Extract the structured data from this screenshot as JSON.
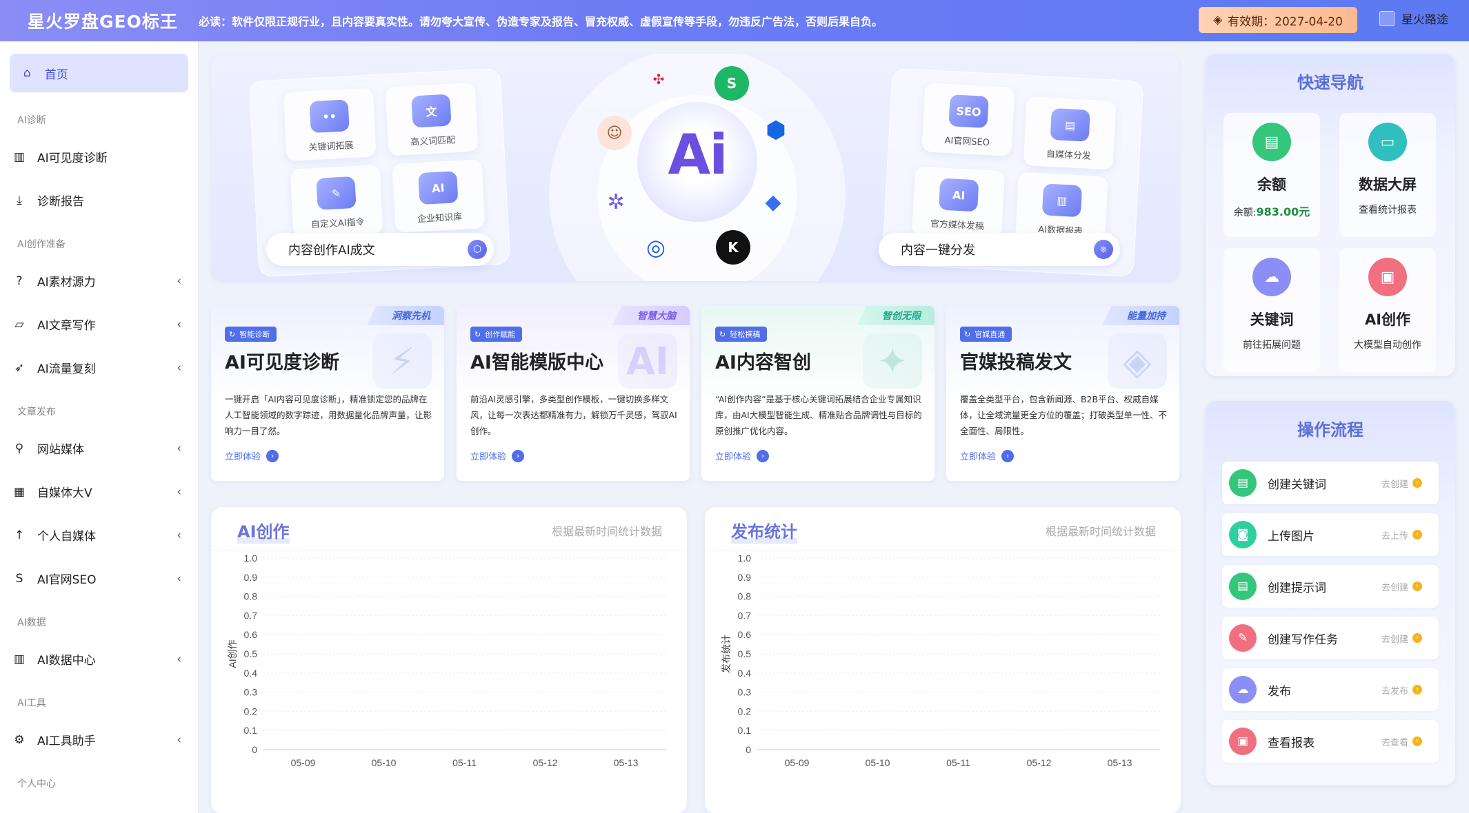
{
  "header": {
    "brand": "星火罗盘GEO标王",
    "notice": "必读：软件仅限正规行业，且内容要真实性。请勿夸大宣传、伪造专家及报告、冒充权威、虚假宣传等手段，勿违反广告法，否则后果自负。",
    "validity": "有效期：2027-04-20",
    "username": "星火路途"
  },
  "sidebar": {
    "home": "首页",
    "sections": [
      {
        "title": "AI诊断",
        "items": [
          {
            "label": "AI可见度诊断",
            "icon": "bar-chart-icon",
            "chevron": false
          },
          {
            "label": "诊断报告",
            "icon": "download-icon",
            "chevron": false
          }
        ]
      },
      {
        "title": "AI创作准备",
        "items": [
          {
            "label": "AI素材源力",
            "icon": "question-icon",
            "chevron": true
          },
          {
            "label": "AI文章写作",
            "icon": "folder-icon",
            "chevron": true
          },
          {
            "label": "AI流量复刻",
            "icon": "rocket-icon",
            "chevron": true
          }
        ]
      },
      {
        "title": "文章发布",
        "items": [
          {
            "label": "网站媒体",
            "icon": "search-icon",
            "chevron": true
          },
          {
            "label": "自媒体大V",
            "icon": "grid-icon",
            "chevron": true
          },
          {
            "label": "个人自媒体",
            "icon": "arrow-up-icon",
            "chevron": true
          },
          {
            "label": "AI官网SEO",
            "icon": "s-icon",
            "chevron": true
          }
        ]
      },
      {
        "title": "AI数据",
        "items": [
          {
            "label": "AI数据中心",
            "icon": "bar-chart-icon",
            "chevron": true
          }
        ]
      },
      {
        "title": "AI工具",
        "items": [
          {
            "label": "AI工具助手",
            "icon": "gear-icon",
            "chevron": true
          }
        ]
      },
      {
        "title": "个人中心",
        "items": []
      }
    ]
  },
  "hero": {
    "left_tiles": [
      "关键词拓展",
      "高义词匹配",
      "自定义AI指令",
      "企业知识库"
    ],
    "left_pill": "内容创作AI成文",
    "right_tiles": [
      "AI官网SEO",
      "自媒体分发",
      "官方媒体发稿",
      "AI数据报表"
    ],
    "right_pill": "内容一键分发",
    "center_text": "Ai"
  },
  "features": [
    {
      "tag": "洞察先机",
      "badge": "智能诊断",
      "title": "AI可见度诊断",
      "desc": "一键开启「AI内容可见度诊断」，精准锁定您的品牌在人工智能领域的数字踪迹，用数据量化品牌声量，让影响力一目了然。",
      "link": "立即体验",
      "color": "#4f6ee8"
    },
    {
      "tag": "智慧大脑",
      "badge": "创作赋能",
      "title": "AI智能模版中心",
      "desc": "前沿AI灵感引擎，多类型创作模板，一键切换多样文风，让每一次表达都精准有力，解锁万千灵感，驾驭AI创作。",
      "link": "立即体验",
      "color": "#4f6ee8"
    },
    {
      "tag": "智创无限",
      "badge": "轻松撰稿",
      "title": "AI内容智创",
      "desc": "“AI创作内容”是基于核心关键词拓展结合企业专属知识库，由AI大模型智能生成、精准贴合品牌调性与目标的原创推广优化内容。",
      "link": "立即体验",
      "color": "#4f6ee8"
    },
    {
      "tag": "能量加持",
      "badge": "官媒直通",
      "title": "官媒投稿发文",
      "desc": "覆盖全类型平台，包含新闻源、B2B平台、权威自媒体，让全域流量更全方位的覆盖；打破类型单一性、不全面性、局限性。",
      "link": "立即体验",
      "color": "#4f6ee8"
    }
  ],
  "panels": [
    {
      "title": "AI创作",
      "subtitle": "根据最新时间统计数据"
    },
    {
      "title": "发布统计",
      "subtitle": "根据最新时间统计数据"
    }
  ],
  "chart_data": [
    {
      "type": "line",
      "title": "AI创作",
      "ylabel": "AI创作",
      "xlabel": "",
      "categories": [
        "05-09",
        "05-10",
        "05-11",
        "05-12",
        "05-13"
      ],
      "yticks": [
        "0",
        "0.1",
        "0.2",
        "0.3",
        "0.4",
        "0.5",
        "0.6",
        "0.7",
        "0.8",
        "0.9",
        "1.0"
      ],
      "ylim": [
        0,
        1
      ],
      "series": [],
      "grid": true
    },
    {
      "type": "line",
      "title": "发布统计",
      "ylabel": "发布统计",
      "xlabel": "",
      "categories": [
        "05-09",
        "05-10",
        "05-11",
        "05-12",
        "05-13"
      ],
      "yticks": [
        "0",
        "0.1",
        "0.2",
        "0.3",
        "0.4",
        "0.5",
        "0.6",
        "0.7",
        "0.8",
        "0.9",
        "1.0"
      ],
      "ylim": [
        0,
        1
      ],
      "series": [],
      "grid": true
    }
  ],
  "quick_nav": {
    "title": "快速导航",
    "items": [
      {
        "name": "余额",
        "sub_prefix": "余额:",
        "sub_value": "983.00元",
        "icon": "clipboard-icon",
        "color": "#34c77b"
      },
      {
        "name": "数据大屏",
        "sub": "查看统计报表",
        "icon": "monitor-icon",
        "color": "#2fbfbf"
      },
      {
        "name": "关键词",
        "sub": "前往拓展问题",
        "icon": "cloud-icon",
        "color": "#8a8ef5"
      },
      {
        "name": "AI创作",
        "sub": "大模型自动创作",
        "icon": "box-icon",
        "color": "#f07080"
      }
    ]
  },
  "workflow": {
    "title": "操作流程",
    "steps": [
      {
        "label": "创建关键词",
        "action": "去创建",
        "icon": "clipboard-icon",
        "color": "#34c77b"
      },
      {
        "label": "上传图片",
        "action": "去上传",
        "icon": "camera-icon",
        "color": "#2fd0a0"
      },
      {
        "label": "创建提示词",
        "action": "去创建",
        "icon": "clipboard-icon",
        "color": "#34c77b"
      },
      {
        "label": "创建写作任务",
        "action": "去创建",
        "icon": "edit-icon",
        "color": "#f07080"
      },
      {
        "label": "发布",
        "action": "去发布",
        "icon": "cloud-icon",
        "color": "#8a8ef5"
      },
      {
        "label": "查看报表",
        "action": "去查看",
        "icon": "box-icon",
        "color": "#f07080"
      }
    ]
  }
}
